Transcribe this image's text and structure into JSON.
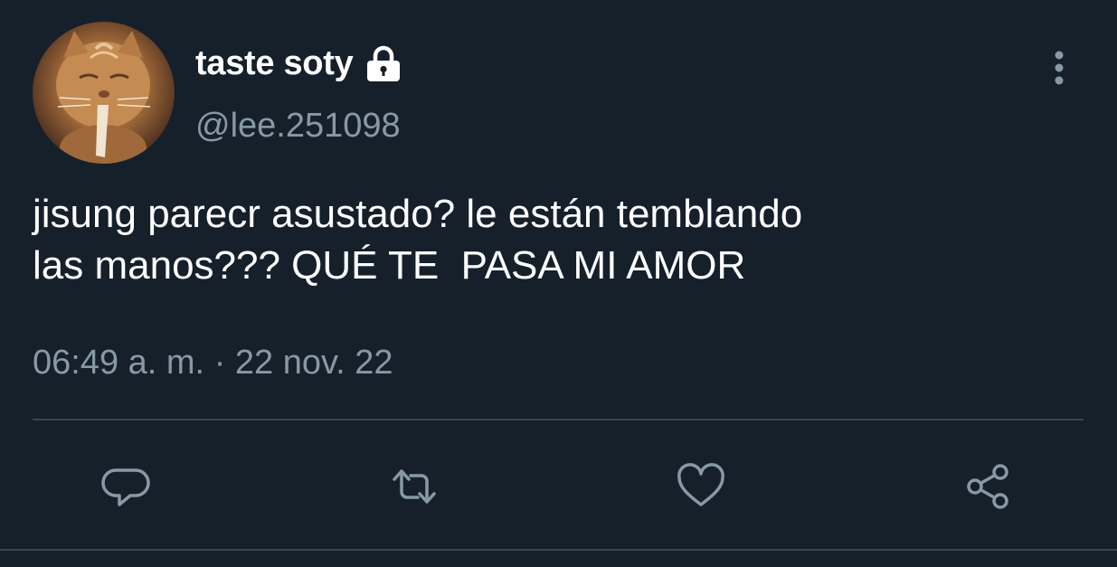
{
  "user": {
    "display_name": "taste soty",
    "handle": "@lee.251098",
    "avatar": "cat-avatar",
    "protected_icon": "lock-icon"
  },
  "tweet": {
    "text": "jisung parecr asustado? le están temblando\nlas manos??? QUÉ TE  PASA MI AMOR",
    "time": "06:49 a. m.",
    "separator": "·",
    "date": "22 nov. 22"
  },
  "actions": [
    {
      "name": "reply",
      "icon": "speech-bubble-icon"
    },
    {
      "name": "retweet",
      "icon": "retweet-icon"
    },
    {
      "name": "like",
      "icon": "heart-icon"
    },
    {
      "name": "share",
      "icon": "share-icon"
    }
  ],
  "menu": {
    "icon": "more-vertical-icon"
  },
  "colors": {
    "background": "#15202b",
    "text": "#ffffff",
    "secondary": "#8899a6",
    "divider": "#38444d"
  }
}
